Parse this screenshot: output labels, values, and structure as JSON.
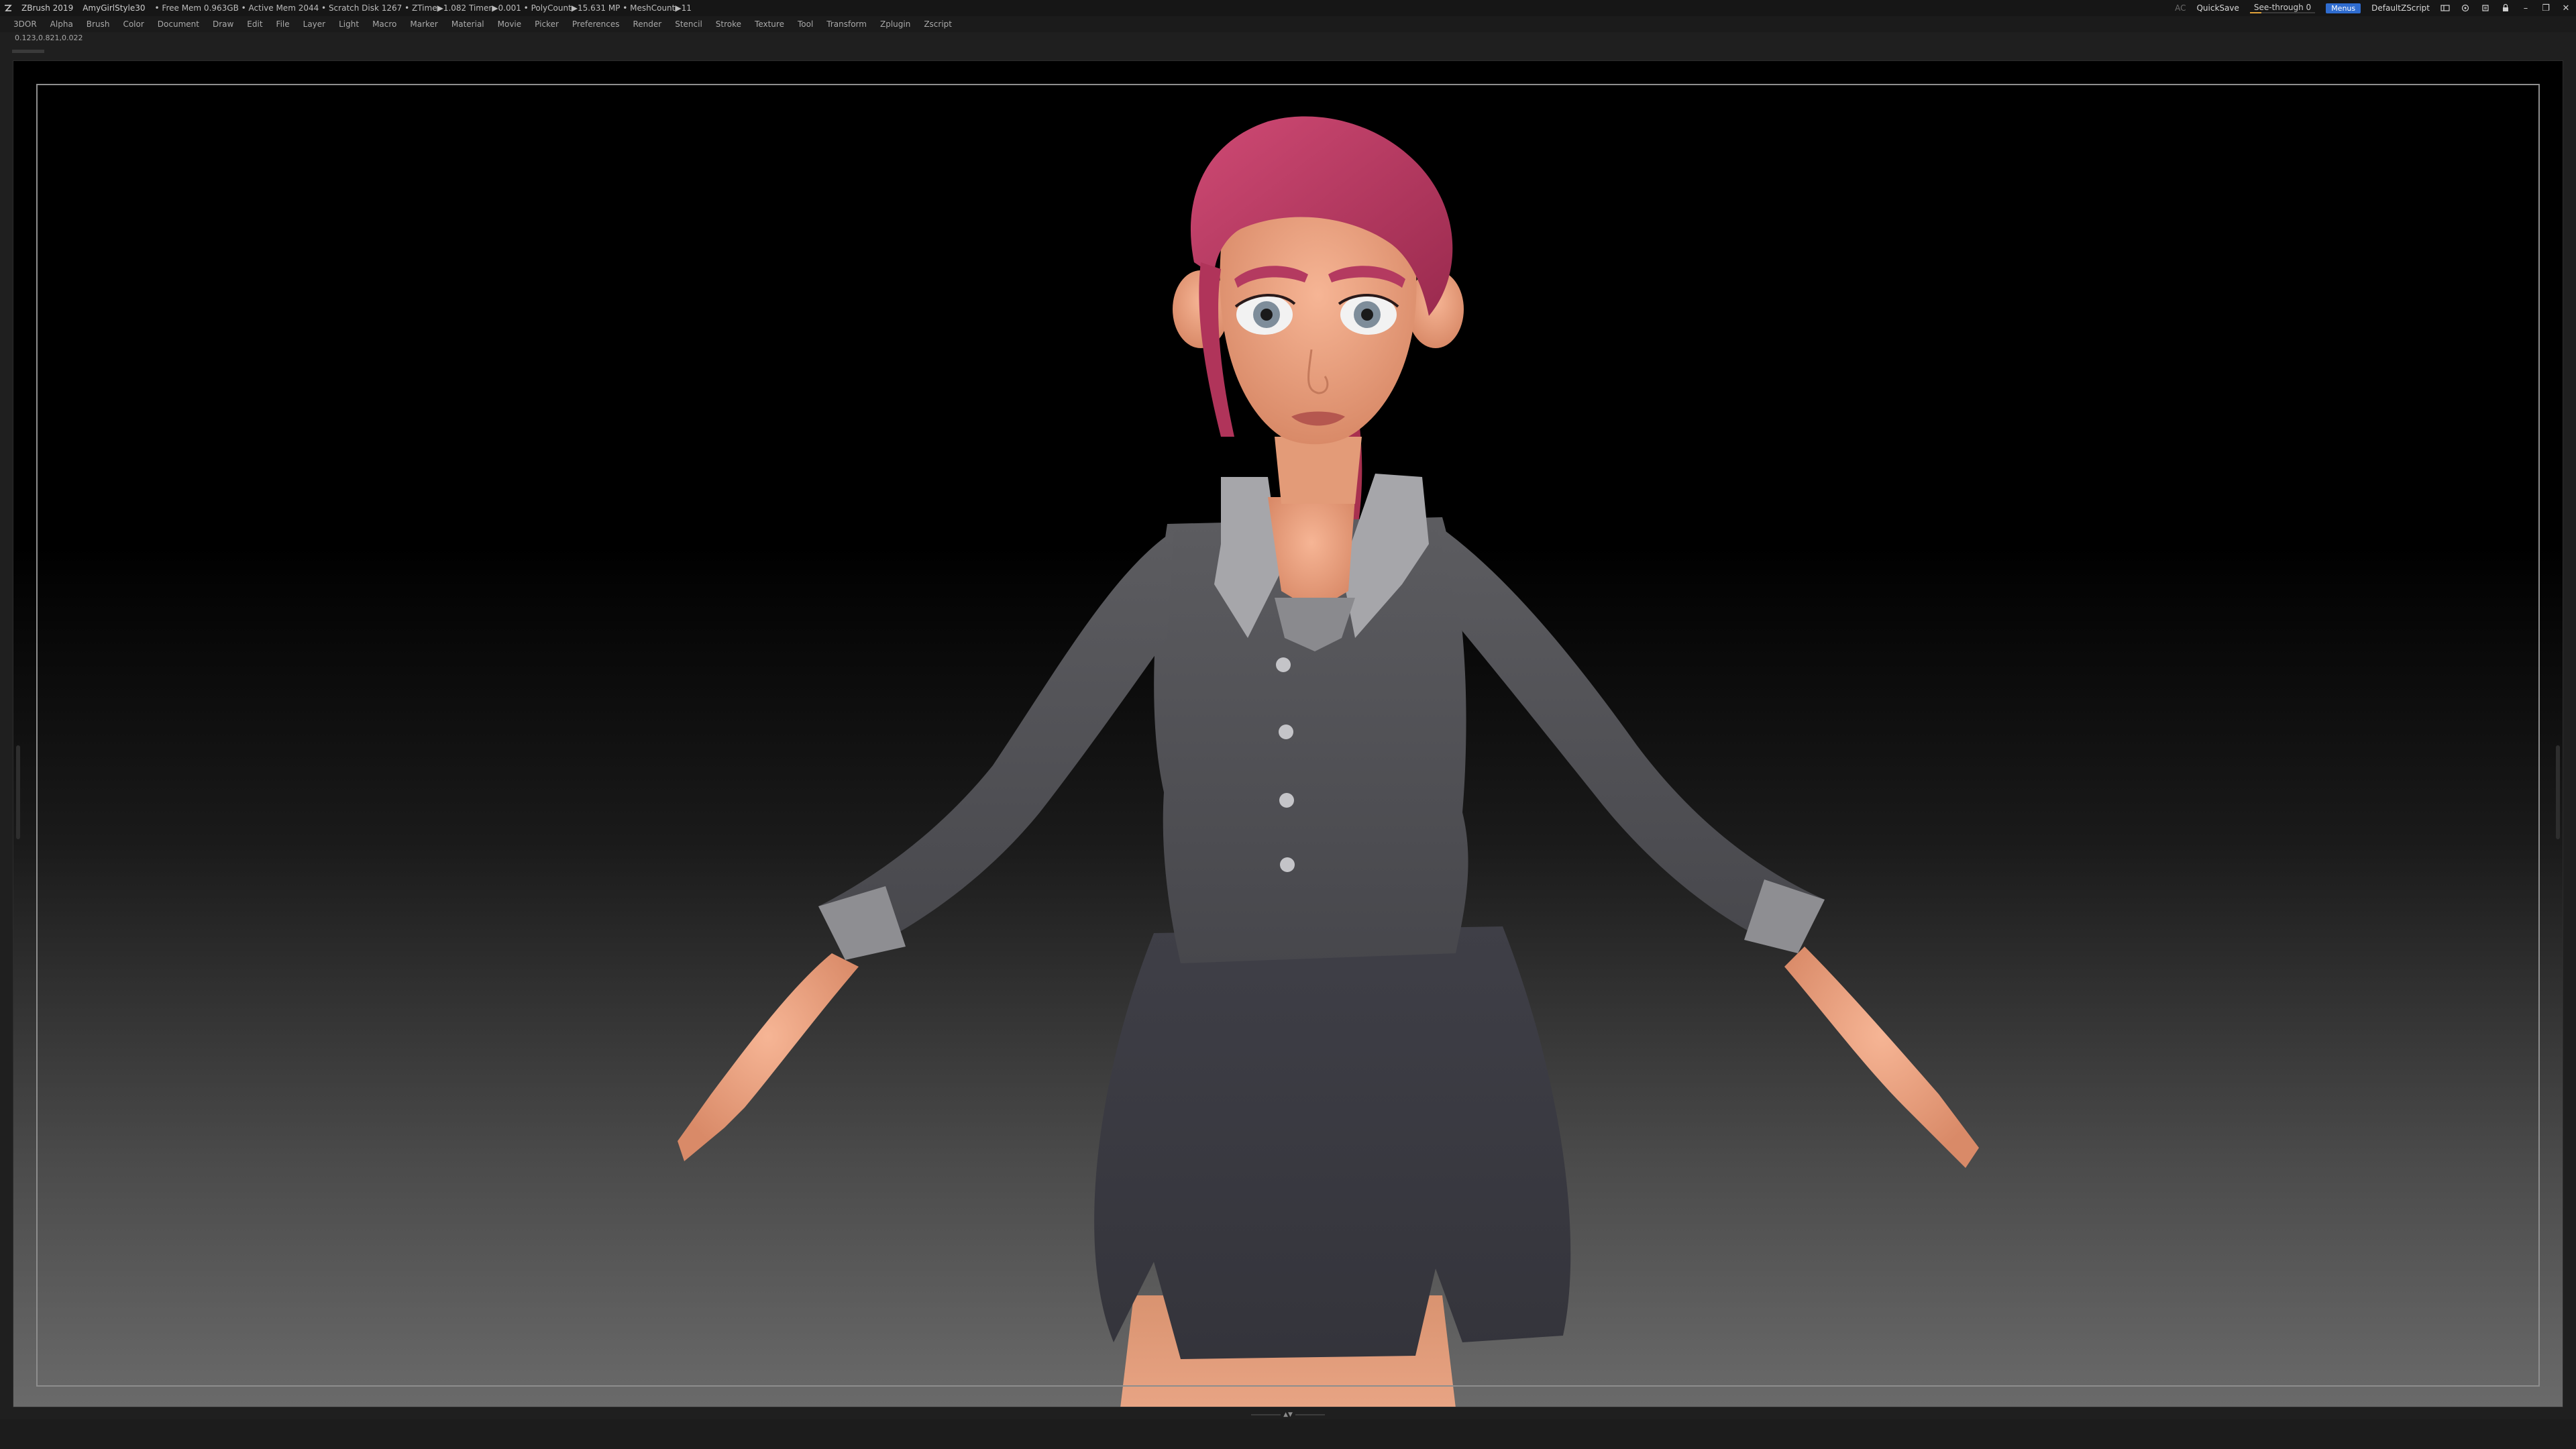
{
  "titlebar": {
    "app_name": "ZBrush 2019",
    "document": "AmyGirlStyle30",
    "stats": "• Free Mem 0.963GB • Active Mem 2044 • Scratch Disk 1267 • ZTime▶1.082 Timer▶0.001 • PolyCount▶15.631 MP • MeshCount▶11",
    "ac_label": "AC",
    "quicksave_label": "QuickSave",
    "see_through_label": "See-through 0",
    "see_through_value": 0,
    "menus_label": "Menus",
    "script_name": "DefaultZScript",
    "accent_color": "#2f6ccf"
  },
  "menubar": {
    "items": [
      "3DOR",
      "Alpha",
      "Brush",
      "Color",
      "Document",
      "Draw",
      "Edit",
      "File",
      "Layer",
      "Light",
      "Macro",
      "Marker",
      "Material",
      "Movie",
      "Picker",
      "Preferences",
      "Render",
      "Stencil",
      "Stroke",
      "Texture",
      "Tool",
      "Transform",
      "Zplugin",
      "Zscript"
    ]
  },
  "info": {
    "coords": "0.123,0.821,0.022"
  },
  "viewport": {
    "background_top": "#000000",
    "background_bottom": "#6a6a6a",
    "subject": "stylized female character in grey cardigan and skirt",
    "hair_color": "#c13a66",
    "skin_color": "#f0a886",
    "cardigan_color": "#545458",
    "skirt_color": "#3c3c44"
  }
}
